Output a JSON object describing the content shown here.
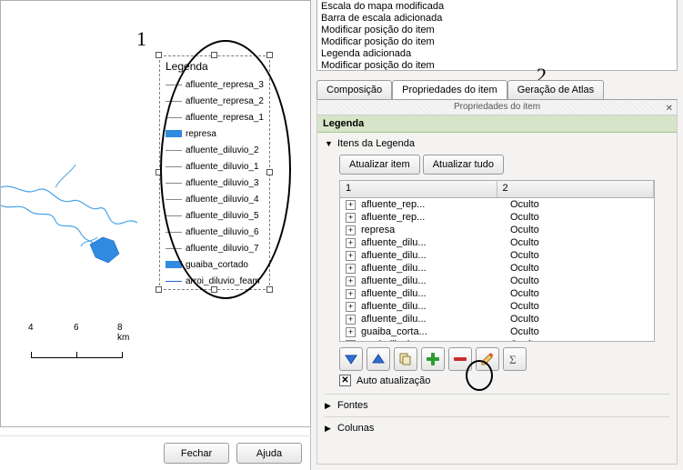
{
  "annotations": {
    "num1": "1",
    "num2": "2"
  },
  "canvas": {
    "legend_title": "Legenda",
    "legend_items": [
      {
        "label": "afluente_represa_3",
        "style": "line"
      },
      {
        "label": "afluente_represa_2",
        "style": "line"
      },
      {
        "label": "afluente_represa_1",
        "style": "line"
      },
      {
        "label": "represa",
        "style": "rect"
      },
      {
        "label": "afluente_diluvio_2",
        "style": "line"
      },
      {
        "label": "afluente_diluvio_1",
        "style": "line"
      },
      {
        "label": "afluente_diluvio_3",
        "style": "line"
      },
      {
        "label": "afluente_diluvio_4",
        "style": "line"
      },
      {
        "label": "afluente_diluvio_5",
        "style": "line"
      },
      {
        "label": "afluente_diluvio_6",
        "style": "line"
      },
      {
        "label": "afluente_diluvio_7",
        "style": "line"
      },
      {
        "label": "guaiba_cortado",
        "style": "rect"
      },
      {
        "label": "arroi_diluvio_feam",
        "style": "blueline"
      }
    ],
    "scale": {
      "l1": "4",
      "l2": "6",
      "l3": "8 km"
    }
  },
  "bottom": {
    "fechar": "Fechar",
    "ajuda": "Ajuda"
  },
  "history": {
    "items": [
      "Escala do mapa modificada",
      "Barra de escala adicionada",
      "Modificar posição do item",
      "Modificar posição do item",
      "Legenda adicionada",
      "Modificar posição do item"
    ]
  },
  "tabs": {
    "composicao": "Composição",
    "prop": "Propriedades do item",
    "atlas": "Geração de Atlas"
  },
  "prop_header": "Propriedades do item",
  "legend_panel": {
    "title": "Legenda",
    "itens_label": "Itens da Legenda",
    "atualizar_item": "Atualizar item",
    "atualizar_tudo": "Atualizar tudo",
    "col1": "1",
    "col2": "2",
    "rows": [
      {
        "name": "afluente_rep...",
        "vis": "Oculto"
      },
      {
        "name": "afluente_rep...",
        "vis": "Oculto"
      },
      {
        "name": "represa",
        "vis": "Oculto"
      },
      {
        "name": "afluente_dilu...",
        "vis": "Oculto"
      },
      {
        "name": "afluente_dilu...",
        "vis": "Oculto"
      },
      {
        "name": "afluente_dilu...",
        "vis": "Oculto"
      },
      {
        "name": "afluente_dilu...",
        "vis": "Oculto"
      },
      {
        "name": "afluente_dilu...",
        "vis": "Oculto"
      },
      {
        "name": "afluente_dilu...",
        "vis": "Oculto"
      },
      {
        "name": "afluente_dilu...",
        "vis": "Oculto"
      },
      {
        "name": "guaiba_corta...",
        "vis": "Oculto"
      },
      {
        "name": "arroi_diluvio_...",
        "vis": "Oculto"
      }
    ],
    "auto_update": "Auto atualização",
    "fontes": "Fontes",
    "colunas": "Colunas"
  }
}
